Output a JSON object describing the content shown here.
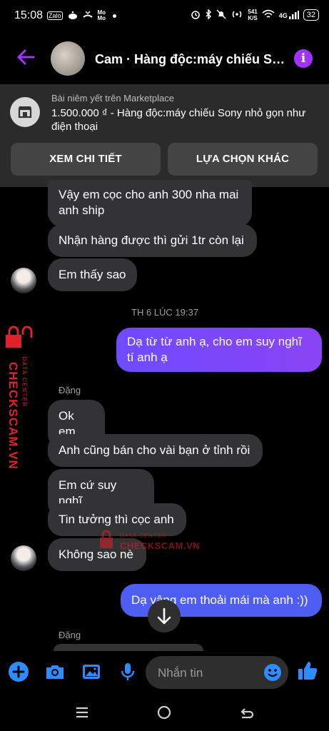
{
  "status_bar": {
    "time": "15:08",
    "left_icons": [
      "Zalo",
      "reddit-icon",
      "missed-call-icon",
      "MoMo",
      "dot-icon"
    ],
    "net_speed_value": "541",
    "net_speed_unit": "K/S",
    "network": "4G",
    "battery": "32"
  },
  "header": {
    "title": "Cam · Hàng độc:máy chiếu Son...",
    "info_icon": "i"
  },
  "marketplace": {
    "subtitle": "Bài niêm yết trên Marketplace",
    "title": "1.500.000 ₫ - Hàng độc:máy chiếu Sony nhỏ gọn như điện thoại",
    "view_button": "XEM CHI TIẾT",
    "other_button": "LỰA CHỌN KHÁC"
  },
  "messages": [
    {
      "from": "them",
      "text": "Vậy em cọc cho anh 300 nha mai anh ship"
    },
    {
      "from": "them",
      "text": "Nhận hàng được thì gửi 1tr còn lại"
    },
    {
      "from": "them",
      "text": "Em thấy sao"
    },
    {
      "from": "system",
      "text": "TH 6 LÚC 19:37"
    },
    {
      "from": "me",
      "text": "Dạ từ từ anh ạ, cho em suy nghĩ tí anh ạ"
    },
    {
      "from": "sender",
      "text": "Đặng"
    },
    {
      "from": "them",
      "text": "Ok em"
    },
    {
      "from": "them",
      "text": "Anh cũng bán cho vài bạn ở tỉnh rồi"
    },
    {
      "from": "them",
      "text": "Em cứ suy nghĩ"
    },
    {
      "from": "them",
      "text": "Tin tưởng thì cọc anh"
    },
    {
      "from": "them",
      "text": "Không sao nè"
    },
    {
      "from": "me",
      "text": "Dạ vâng em thoải mái mà anh :))"
    },
    {
      "from": "sender",
      "text": "Đặng"
    }
  ],
  "watermark": {
    "side_brand": "CHECKSCAM.VN",
    "side_caption": "DATA CENTER",
    "center_caption": "DATA CENTER",
    "center_brand": "CHECKSCAM.VN"
  },
  "composer": {
    "placeholder": "Nhắn tin",
    "icons": [
      "plus-icon",
      "camera-icon",
      "image-icon",
      "mic-icon",
      "emoji-icon",
      "like-icon"
    ]
  },
  "nav": {
    "icons": [
      "recents-icon",
      "home-icon",
      "back-icon"
    ]
  },
  "colors": {
    "accent": "#a033ff",
    "my_bubble_gradient": "#7b4cff",
    "my_bubble_blue": "#4f5ef2",
    "their_bubble": "#333335",
    "composer_icon": "#2d8cff",
    "watermark_red": "#e0202a"
  }
}
